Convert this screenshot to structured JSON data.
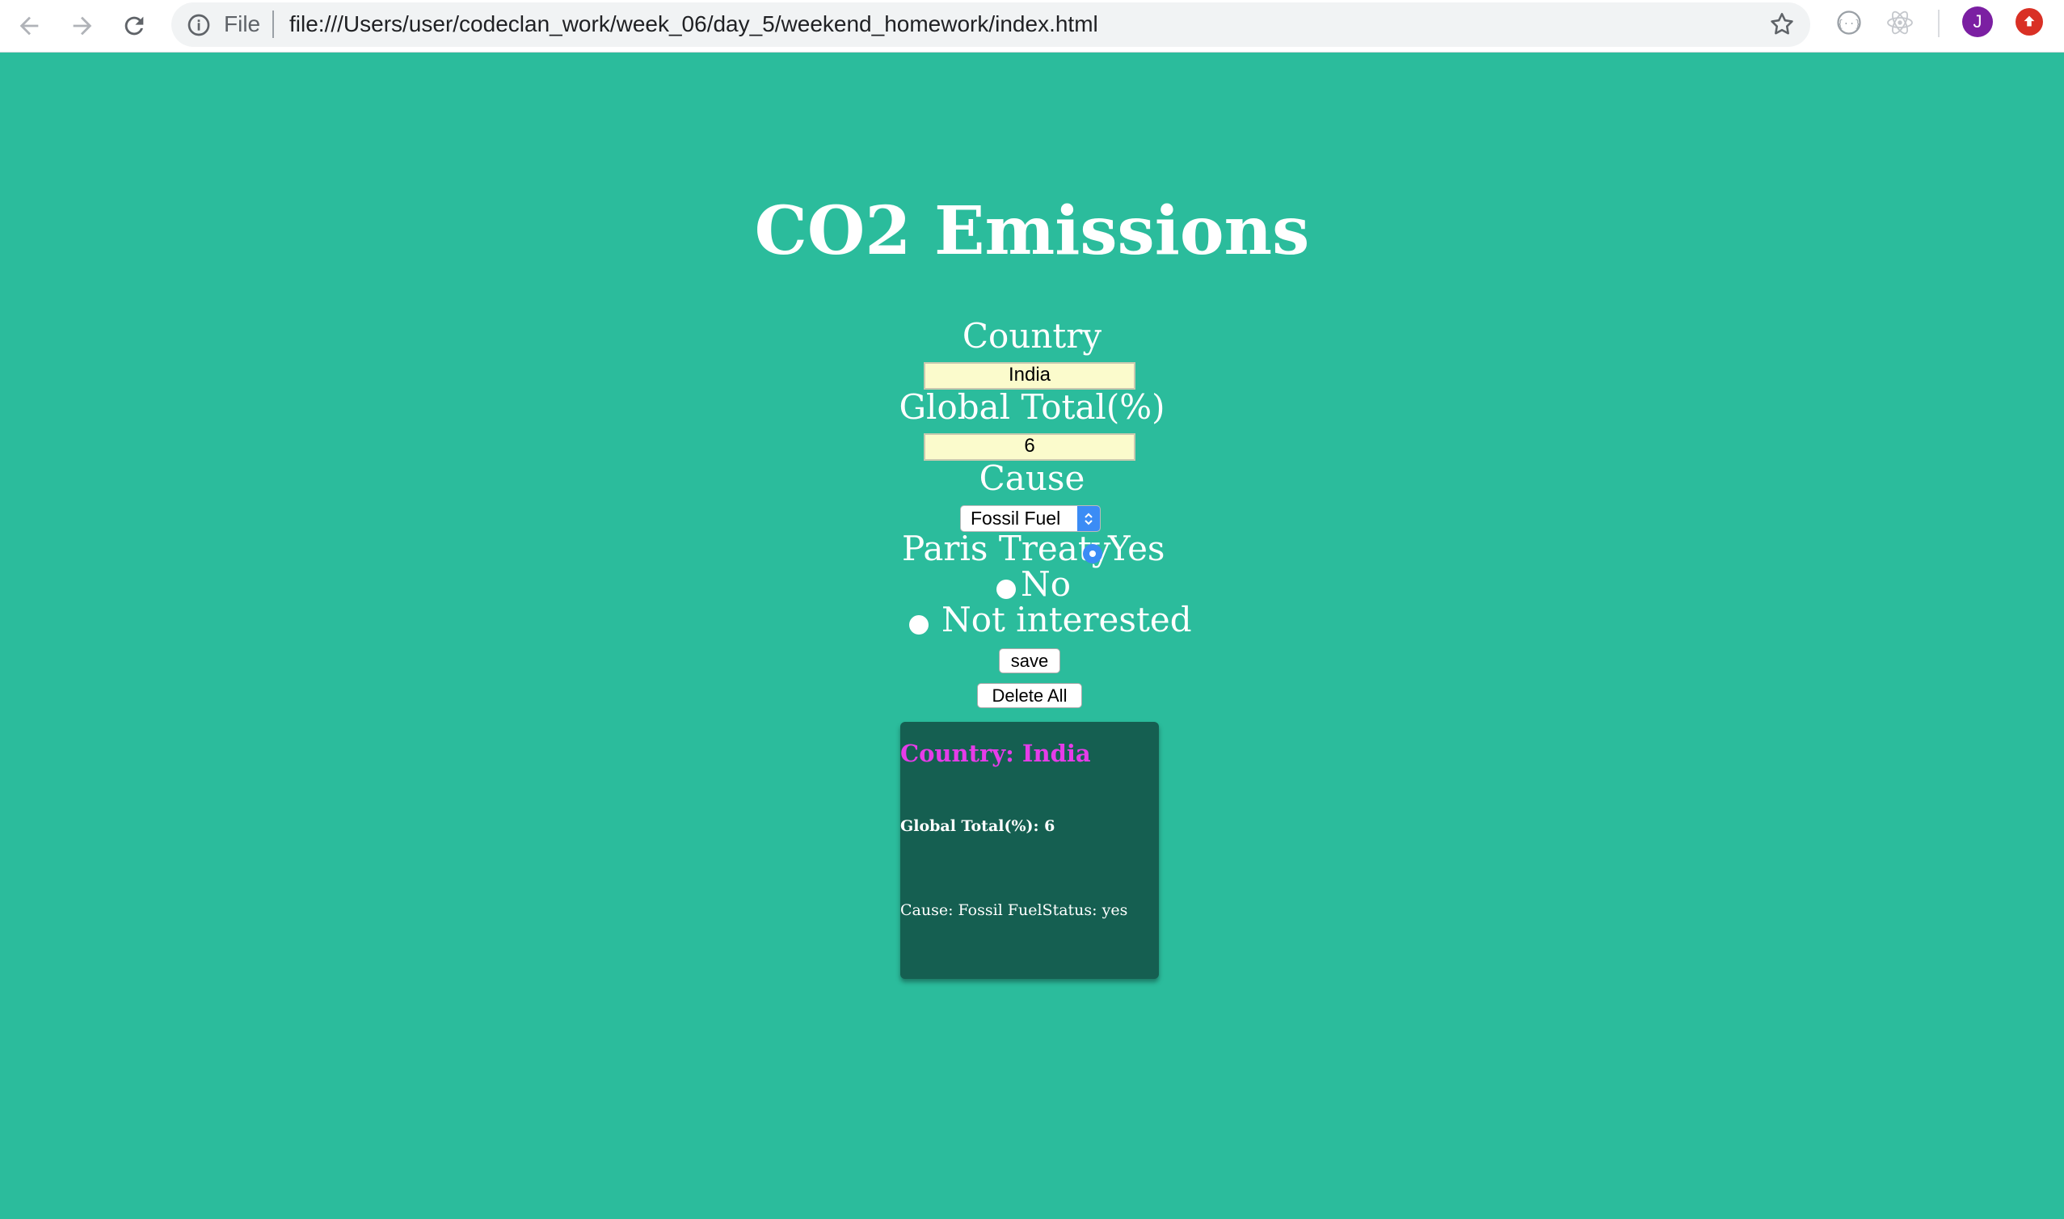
{
  "browser": {
    "file_label": "File",
    "url": "file:///Users/user/codeclan_work/week_06/day_5/weekend_homework/index.html",
    "avatar_initial": "J"
  },
  "page": {
    "title": "CO2 Emissions",
    "country_label": "Country",
    "country_value": "India",
    "global_total_label": "Global Total(%)",
    "global_total_value": "6",
    "cause_label": "Cause",
    "cause_selected": "Fossil Fuel",
    "paris_label": "Paris Treaty",
    "radio_yes": "Yes",
    "radio_no": "No",
    "radio_not_interested": "Not interested",
    "save_label": "save",
    "delete_all_label": "Delete All"
  },
  "card": {
    "country": "Country: India",
    "global_total": "Global Total(%): 6",
    "cause_status": "Cause: Fossil FuelStatus: yes"
  },
  "colors": {
    "background": "#2bbc9c",
    "card": "#155f51",
    "card_title": "#e63ce8",
    "input_bg": "#fbfbcc",
    "accent": "#3b8cf5"
  }
}
